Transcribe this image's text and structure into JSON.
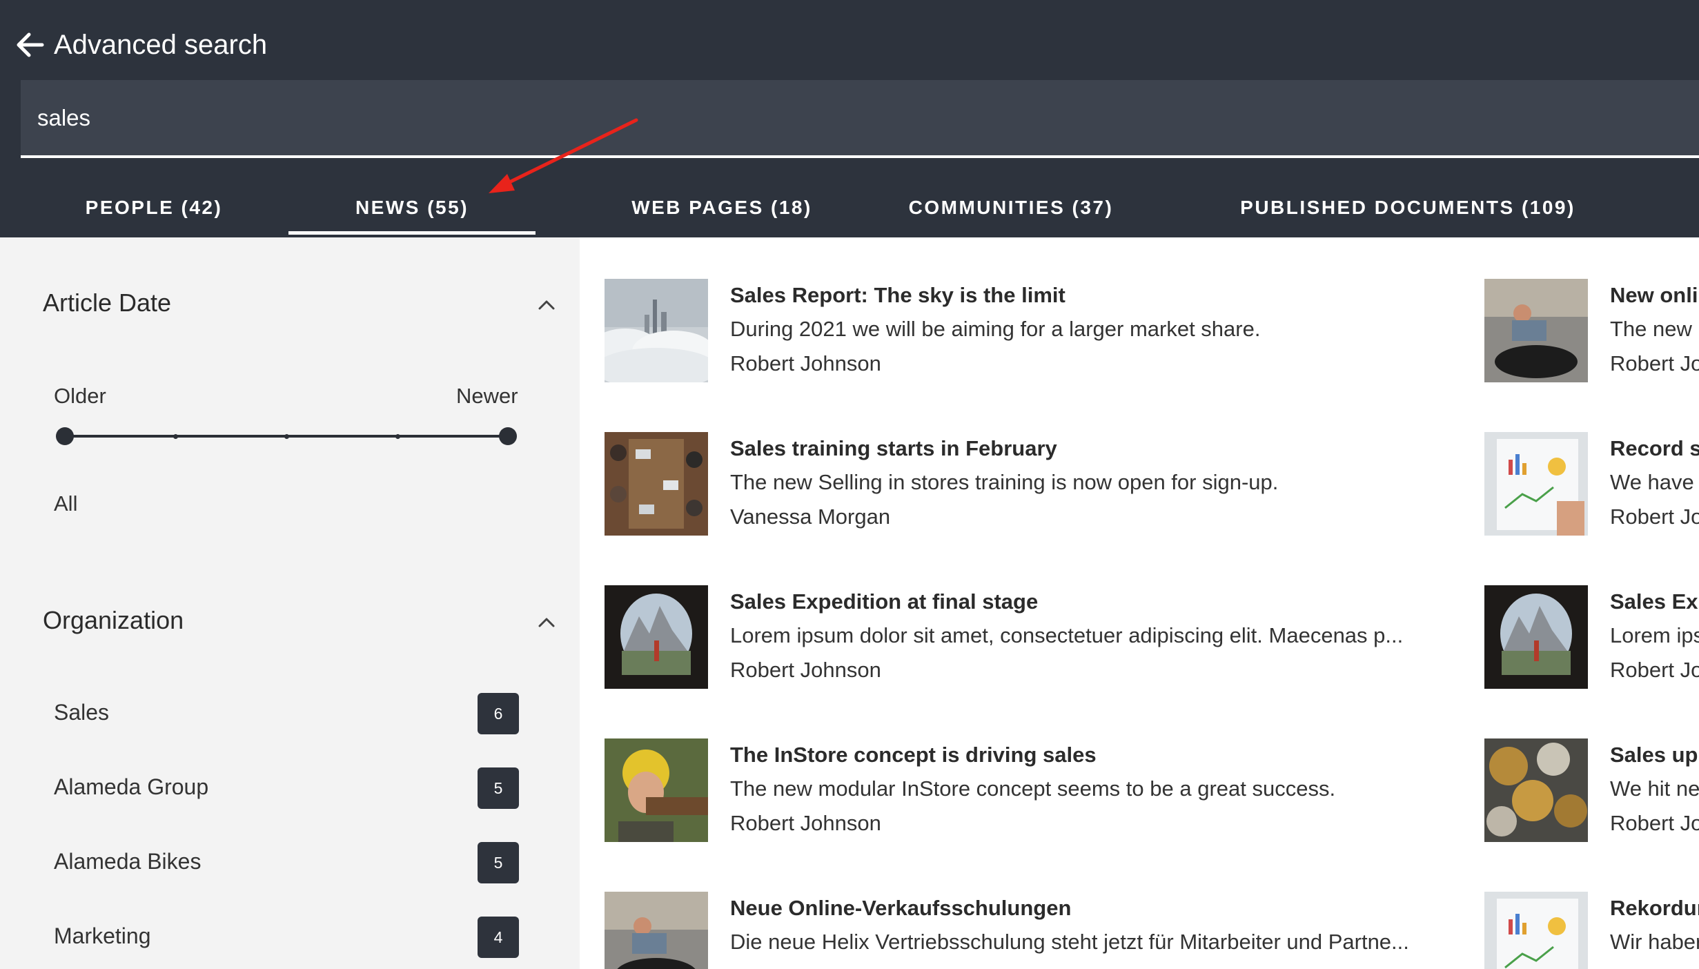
{
  "header": {
    "title": "Advanced search",
    "search_value": "sales"
  },
  "tabs": [
    {
      "label": "PEOPLE (42)"
    },
    {
      "label": "NEWS (55)",
      "active": true
    },
    {
      "label": "WEB PAGES (18)"
    },
    {
      "label": "COMMUNITIES (37)"
    },
    {
      "label": "PUBLISHED DOCUMENTS (109)"
    }
  ],
  "filters": {
    "article_date": {
      "title": "Article Date",
      "older_label": "Older",
      "newer_label": "Newer",
      "value": "All"
    },
    "organization": {
      "title": "Organization",
      "items": [
        {
          "label": "Sales",
          "count": "6"
        },
        {
          "label": "Alameda Group",
          "count": "5"
        },
        {
          "label": "Alameda Bikes",
          "count": "5"
        },
        {
          "label": "Marketing",
          "count": "4"
        }
      ]
    }
  },
  "results_left": [
    {
      "title": "Sales Report: The sky is the limit",
      "desc": "During 2021 we will be aiming for a larger market share.",
      "author": "Robert Johnson",
      "image": "clouds-skyline"
    },
    {
      "title": "Sales training starts in February",
      "desc": "The new Selling in stores training is now open for sign-up.",
      "author": "Vanessa Morgan",
      "image": "meeting-table"
    },
    {
      "title": "Sales Expedition at final stage",
      "desc": "Lorem ipsum dolor sit amet, consectetuer adipiscing elit. Maecenas p...",
      "author": "Robert Johnson",
      "image": "cave-mountains"
    },
    {
      "title": "The InStore concept is driving sales",
      "desc": "The new modular InStore concept seems to be a great success.",
      "author": "Robert Johnson",
      "image": "kid-helmet"
    },
    {
      "title": "Neue Online-Verkaufsschulungen",
      "desc": "Die neue Helix Vertriebsschulung steht jetzt für Mitarbeiter und Partne...",
      "author": "",
      "image": "tire-workout"
    }
  ],
  "results_right": [
    {
      "title": "New onlin",
      "desc": "The new",
      "author": "Robert Jo",
      "image": "tire-workout"
    },
    {
      "title": "Record sa",
      "desc": "We have",
      "author": "Robert Jo",
      "image": "charts-paper"
    },
    {
      "title": "Sales Exp",
      "desc": "Lorem ips",
      "author": "Robert Jo",
      "image": "cave-mountains"
    },
    {
      "title": "Sales up",
      "desc": "We hit ne",
      "author": "Robert Jo",
      "image": "coins"
    },
    {
      "title": "Rekordur",
      "desc": "Wir haber",
      "author": "",
      "image": "charts-paper"
    }
  ],
  "colors": {
    "header_bg": "#2d333d",
    "search_bg": "#3d434e",
    "sidebar_bg": "#f3f3f3",
    "badge_bg": "#2e333c",
    "annotation_arrow": "#e8231b"
  }
}
